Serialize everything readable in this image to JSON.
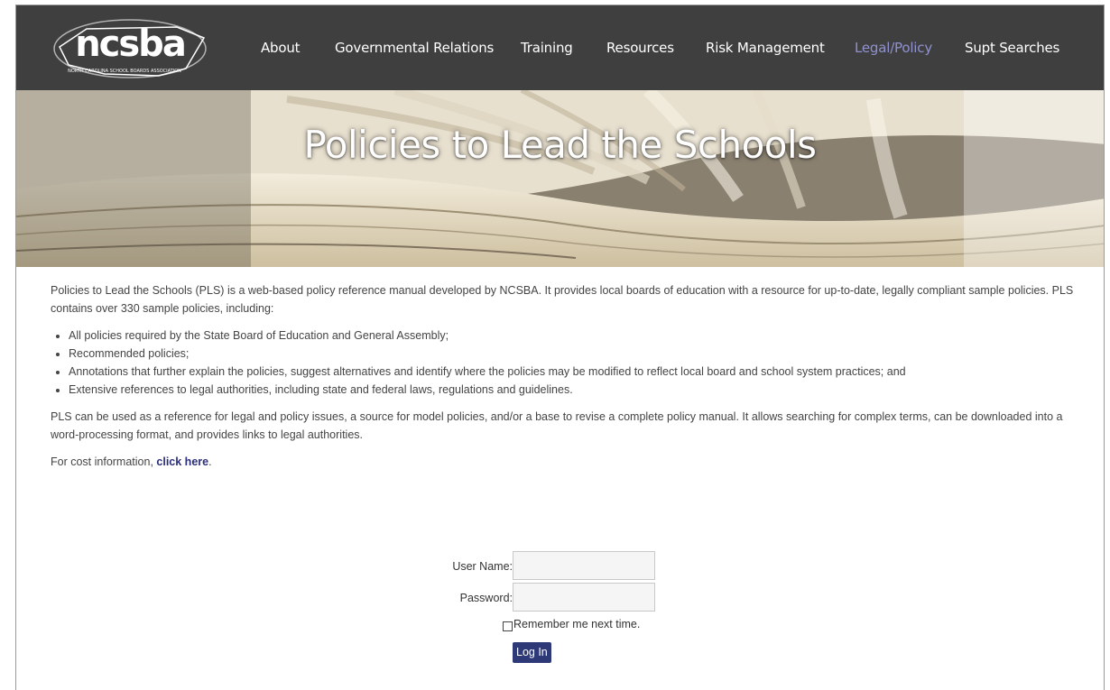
{
  "nav": {
    "logo_text": "ncsba",
    "logo_subtext": "NORTH CAROLINA SCHOOL BOARDS ASSOCIATION",
    "items": [
      "About",
      "Governmental Relations",
      "Training",
      "Resources",
      "Risk Management",
      "Legal/Policy",
      "Supt Searches"
    ],
    "active": "Legal/Policy",
    "colors": {
      "bar": "#3f3f3f",
      "active": "#8f92cf"
    }
  },
  "hero": {
    "title": "Policies to Lead the Schools"
  },
  "content": {
    "intro": "Policies to Lead the Schools (PLS) is a web-based policy reference manual developed by NCSBA.  It provides local boards of education with a resource for up-to-date, legally compliant sample policies.  PLS contains over 330 sample policies, including:",
    "bullets": [
      "All policies required by the State Board of Education and General Assembly;",
      "Recommended policies;",
      "Annotations that further explain the policies, suggest alternatives and identify where the policies may be modified to reflect local board and school system practices; and",
      "Extensive references to legal authorities, including state and federal laws, regulations and guidelines."
    ],
    "usage": "PLS can be used as a reference for legal and policy issues, a source for model policies, and/or a base to revise a complete policy manual.  It allows searching for complex terms, can be downloaded into a word-processing format, and provides links to legal authorities.",
    "cost_prefix": "For cost information, ",
    "cost_link": "click here",
    "cost_suffix": "."
  },
  "login": {
    "username_label": "User Name:",
    "username_value": "",
    "password_label": "Password:",
    "password_value": "",
    "remember_label": "Remember me next time.",
    "remember_checked": false,
    "submit_label": "Log In",
    "button_color": "#2e3a78"
  }
}
